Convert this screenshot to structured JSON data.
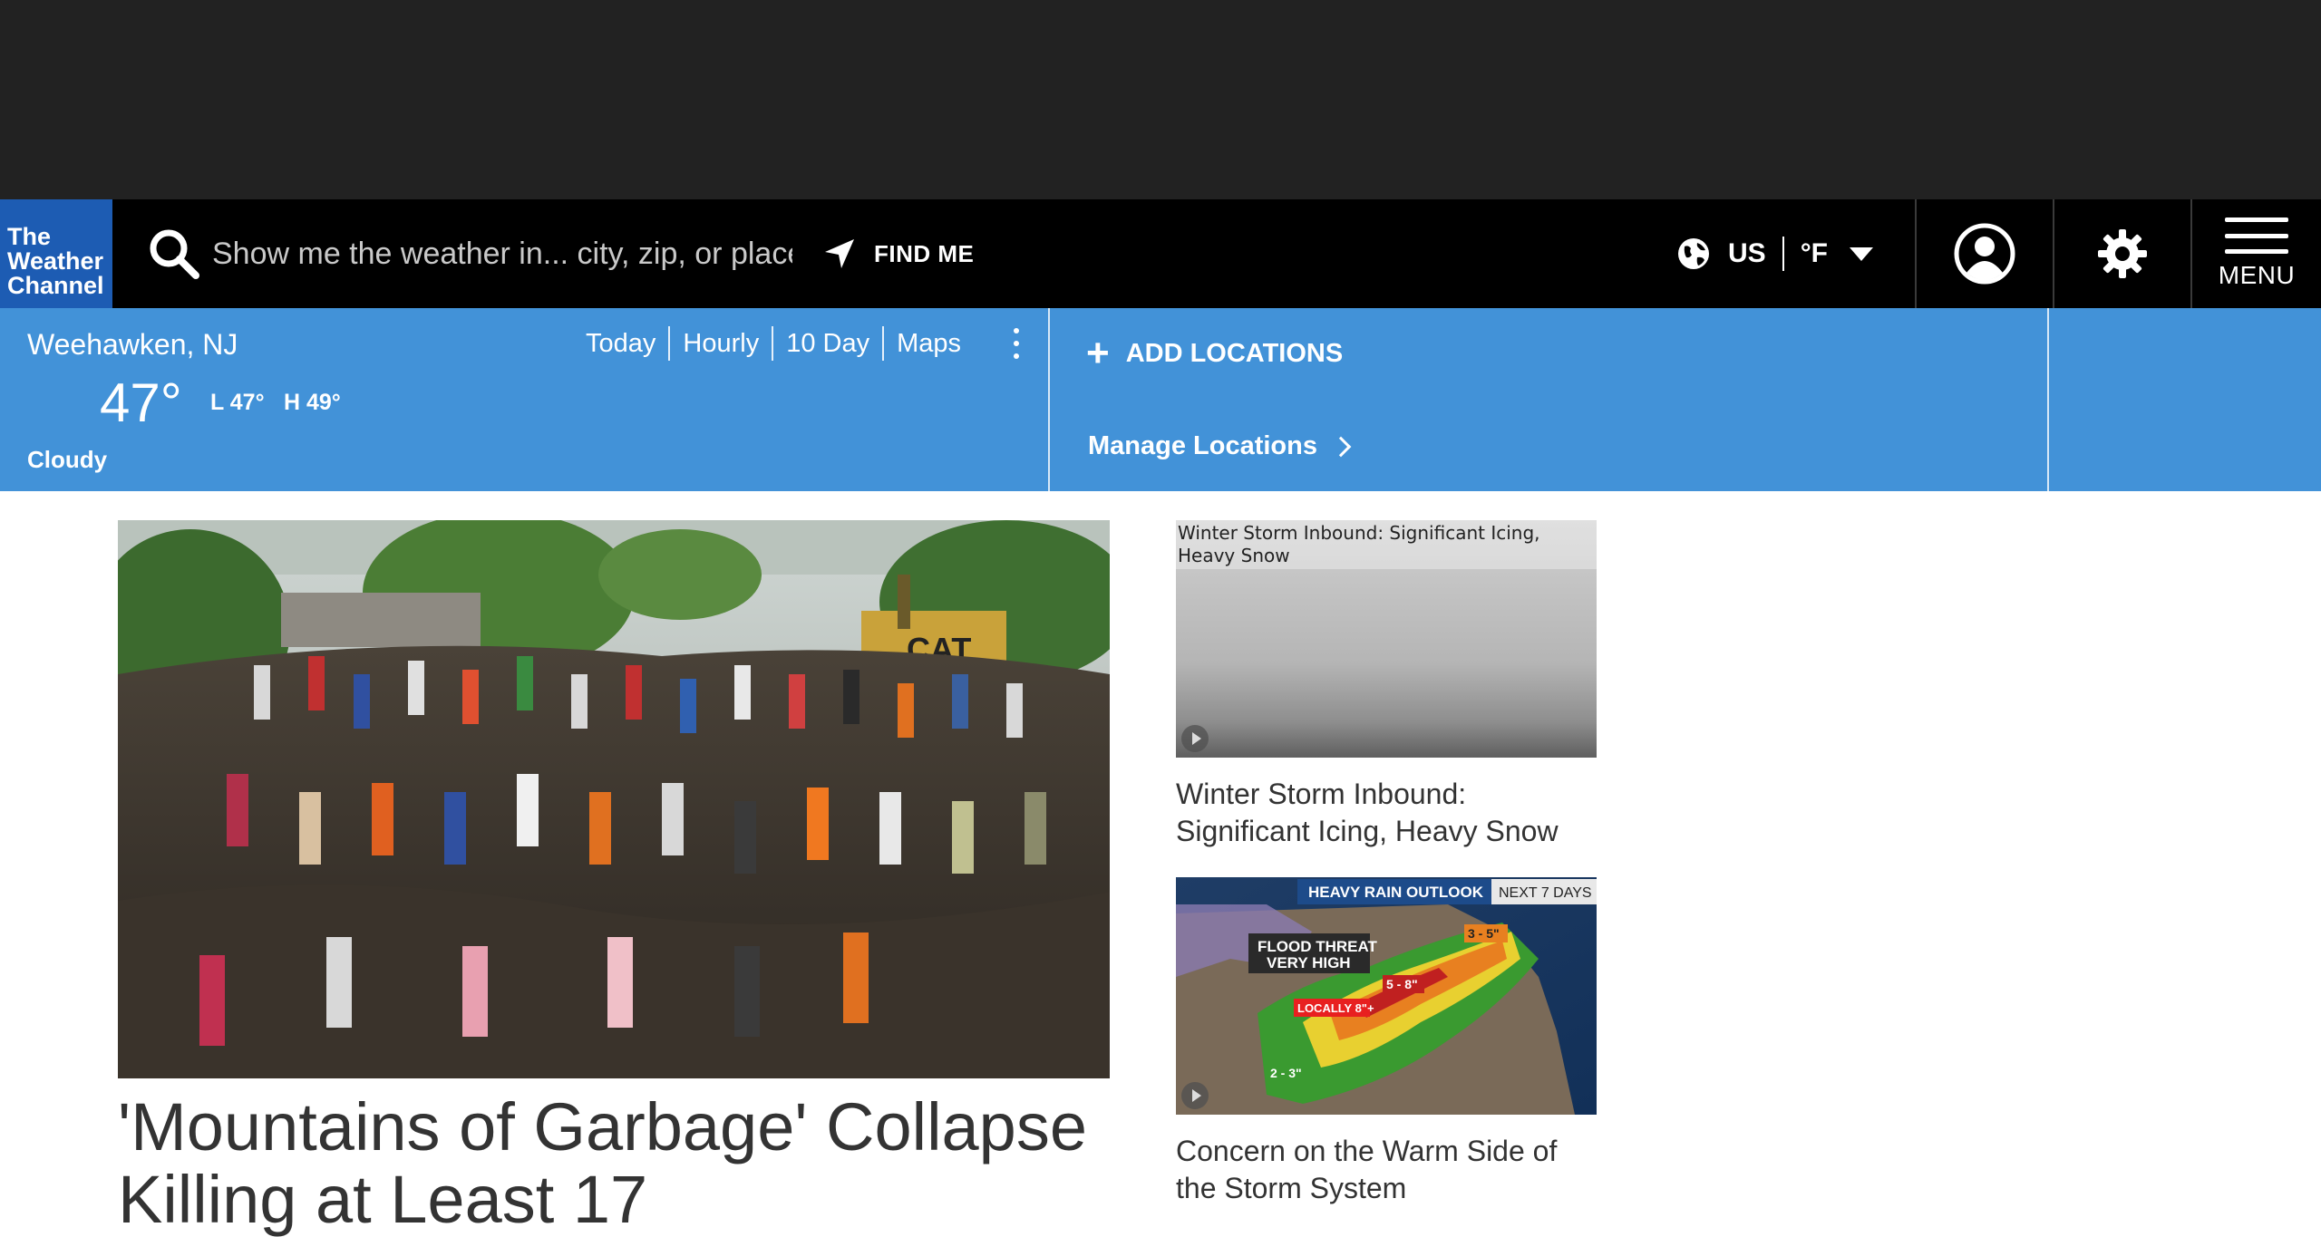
{
  "header": {
    "logo_lines": [
      "The",
      "Weather",
      "Channel"
    ],
    "search_placeholder": "Show me the weather in... city, zip, or place",
    "find_me": "FIND ME",
    "region": "US",
    "unit": "°F",
    "menu_label": "MENU",
    "colors": {
      "background": "#000000",
      "logo": "#1d5cb3",
      "topbar": "#222222"
    }
  },
  "location": {
    "name": "Weehawken, NJ",
    "temperature": "47°",
    "low": "L 47°",
    "high": "H 49°",
    "condition": "Cloudy",
    "tabs": [
      "Today",
      "Hourly",
      "10 Day",
      "Maps"
    ],
    "add_locations": "ADD LOCATIONS",
    "manage_locations": "Manage Locations",
    "colors": {
      "bar": "#4292d8"
    }
  },
  "hero": {
    "title": "'Mountains of Garbage' Collapse Killing at Least 17"
  },
  "videos": [
    {
      "thumb_caption": "Winter Storm Inbound: Significant Icing, Heavy Snow",
      "title": "Winter Storm Inbound: Significant Icing, Heavy Snow"
    },
    {
      "thumb_labels": {
        "outlook": "HEAVY RAIN OUTLOOK",
        "period": "NEXT 7 DAYS",
        "flood_1": "FLOOD THREAT",
        "flood_2": "VERY HIGH",
        "locally": "LOCALLY 8\"+",
        "range_3_5": "3 - 5\"",
        "range_5_8": "5 - 8\"",
        "range_2_3": "2 - 3\""
      },
      "title": "Concern on the Warm Side of the Storm System"
    }
  ]
}
